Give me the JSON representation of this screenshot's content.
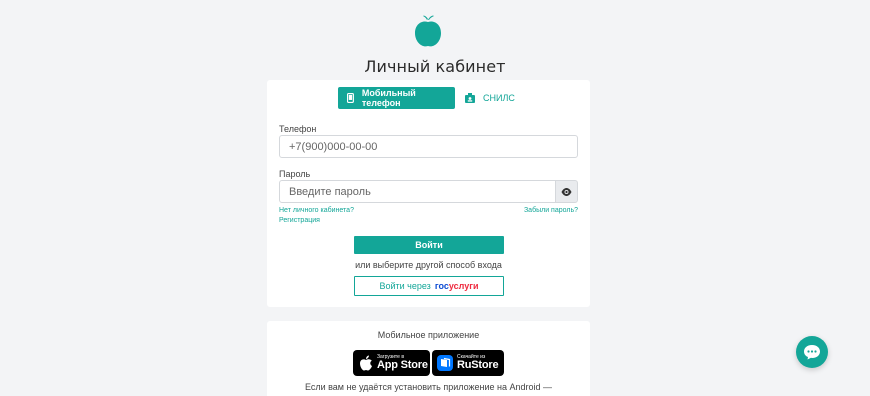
{
  "page": {
    "title": "Личный кабинет"
  },
  "tabs": [
    {
      "label": "Мобильный телефон",
      "active": true,
      "icon": "phone-icon"
    },
    {
      "label": "СНИЛС",
      "active": false,
      "icon": "id-card-icon"
    }
  ],
  "phone": {
    "label": "Телефон",
    "placeholder": "+7(900)000-00-00"
  },
  "password": {
    "label": "Пароль",
    "placeholder": "Введите пароль"
  },
  "links": {
    "no_account": "Нет личного кабинета?",
    "register": "Регистрация",
    "forgot": "Забыли пароль?"
  },
  "login_button": "Войти",
  "alt_text": "или выберите другой способ входа",
  "gosuslugi": {
    "prefix": "Войти через",
    "brand_a": "гос",
    "brand_b": "услуги"
  },
  "app": {
    "title": "Мобильное приложение",
    "appstore": {
      "small": "Загрузите в",
      "big": "App Store"
    },
    "rustore": {
      "small": "Скачайте из",
      "big": "RuStore"
    },
    "note": "Если вам не удаётся установить приложение на Android —"
  },
  "colors": {
    "accent": "#13a698",
    "gos_blue": "#0d4cd3",
    "gos_red": "#ee2a3f"
  }
}
